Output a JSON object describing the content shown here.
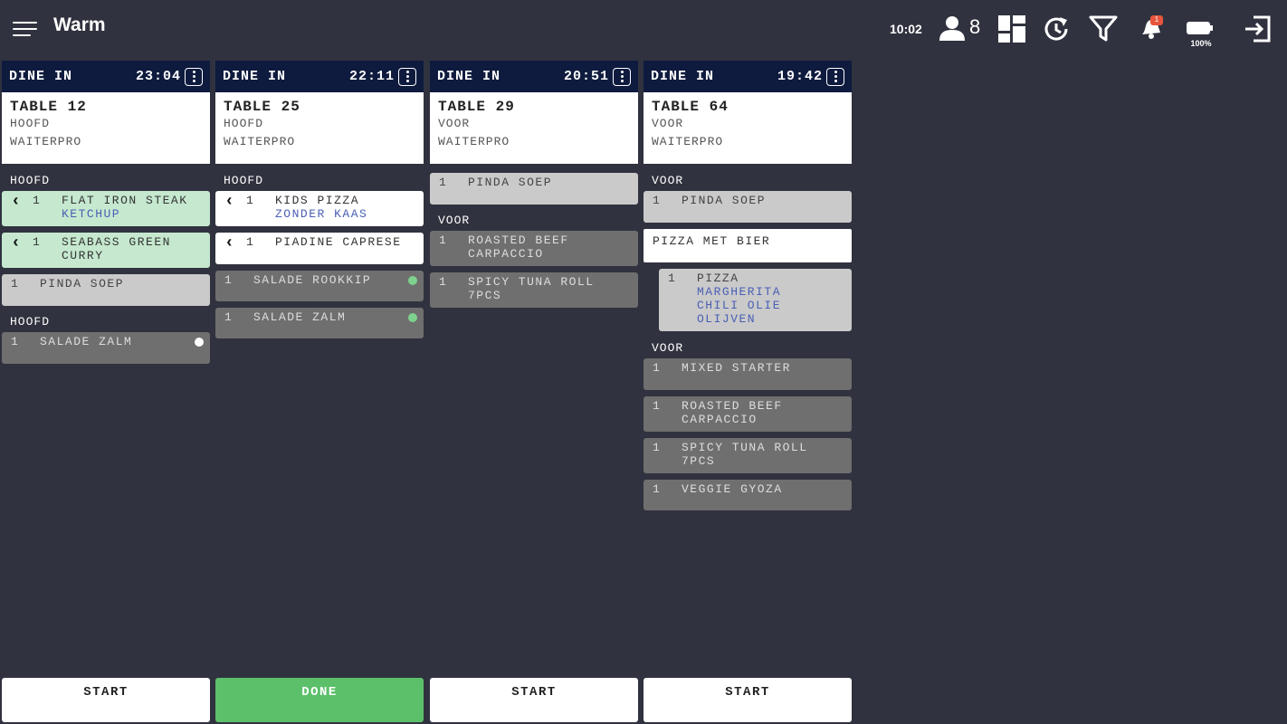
{
  "app": {
    "title": "Warm"
  },
  "status": {
    "time": "10:02",
    "users": "8",
    "notifications": "1",
    "battery": "100%"
  },
  "icons": {
    "menu": "hamburger-menu-icon",
    "user": "person-icon",
    "layout": "dashboard-grid-icon",
    "history": "history-icon",
    "filter": "filter-icon",
    "notify": "bell-icon",
    "battery": "battery-icon",
    "logout": "logout-icon"
  },
  "colors": {
    "background": "#30323f",
    "header": "#0e1b3e",
    "done": "#5cc06b",
    "ready_green": "#c5e8cf",
    "modifier": "#4a5fb4"
  },
  "orders": [
    {
      "type": "DINE IN",
      "timer": "23:04",
      "table": "TABLE 12",
      "course": "HOOFD",
      "source": "WAITERPRO",
      "footer": "START",
      "s1": "HOOFD",
      "i1": {
        "qty": "1",
        "name": "FLAT IRON STEAK",
        "mod": "KETCHUP"
      },
      "i2": {
        "qty": "1",
        "name": "SEABASS GREEN CURRY"
      },
      "i3": {
        "qty": "1",
        "name": "PINDA SOEP"
      },
      "s2": "HOOFD",
      "i4": {
        "qty": "1",
        "name": "SALADE ZALM"
      }
    },
    {
      "type": "DINE IN",
      "timer": "22:11",
      "table": "TABLE 25",
      "course": "HOOFD",
      "source": "WAITERPRO",
      "footer": "DONE",
      "s1": "HOOFD",
      "i1": {
        "qty": "1",
        "name": "KIDS PIZZA",
        "mod": "ZONDER KAAS"
      },
      "i2": {
        "qty": "1",
        "name": "PIADINE CAPRESE"
      },
      "i3": {
        "qty": "1",
        "name": "SALADE ROOKKIP"
      },
      "i4": {
        "qty": "1",
        "name": "SALADE ZALM"
      }
    },
    {
      "type": "DINE IN",
      "timer": "20:51",
      "table": "TABLE 29",
      "course": "VOOR",
      "source": "WAITERPRO",
      "footer": "START",
      "i1": {
        "qty": "1",
        "name": "PINDA SOEP"
      },
      "s1": "VOOR",
      "i2": {
        "qty": "1",
        "name": "ROASTED BEEF CARPACCIO"
      },
      "i3": {
        "qty": "1",
        "name": "SPICY TUNA ROLL 7PCS"
      }
    },
    {
      "type": "DINE IN",
      "timer": "19:42",
      "table": "TABLE 64",
      "course": "VOOR",
      "source": "WAITERPRO",
      "footer": "START",
      "s1": "VOOR",
      "i1": {
        "qty": "1",
        "name": "PINDA SOEP"
      },
      "group": "PIZZA MET BIER",
      "g1": {
        "qty": "1",
        "name": "PIZZA",
        "mod1": "MARGHERITA",
        "mod2": "CHILI OLIE",
        "mod3": "OLIJVEN"
      },
      "s2": "VOOR",
      "i2": {
        "qty": "1",
        "name": "MIXED STARTER"
      },
      "i3": {
        "qty": "1",
        "name": "ROASTED BEEF CARPACCIO"
      },
      "i4": {
        "qty": "1",
        "name": "SPICY TUNA ROLL 7PCS"
      },
      "i5": {
        "qty": "1",
        "name": "VEGGIE GYOZA"
      }
    }
  ]
}
